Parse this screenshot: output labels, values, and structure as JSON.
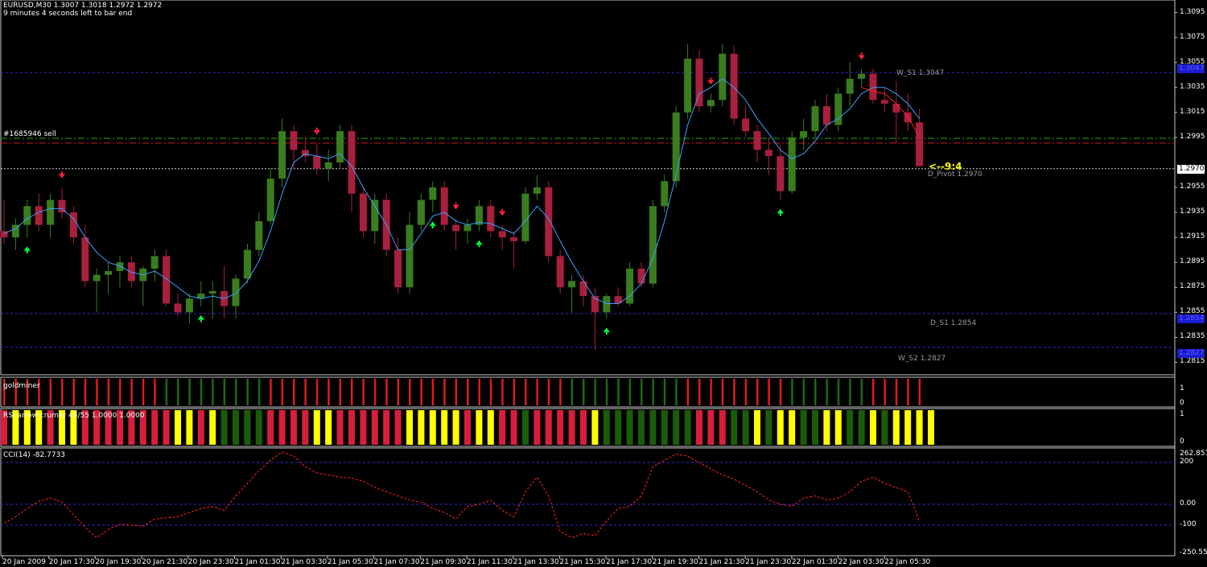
{
  "header": {
    "symbol_ohlc": "EURUSD,M30  1.3007 1.3018 1.2972 1.2972",
    "timer": "9 minutes 4 seconds left to bar end"
  },
  "order_label": "#1685946 sell",
  "countdown_label": "<--9:4",
  "price_axis": [
    "1.3095",
    "1.3075",
    "1.3055",
    "1.3035",
    "1.3015",
    "1.2995",
    "1.2955",
    "1.2935",
    "1.2915",
    "1.2895",
    "1.2875",
    "1.2855",
    "1.2835",
    "1.2815"
  ],
  "levels": {
    "ws1": {
      "text": "W_S1 1.3047",
      "box": "1.3047",
      "price": 1.3047,
      "color": "#2b2bd6"
    },
    "dpivot": {
      "text": "D_Pivot 1.2970",
      "box": "1.2970",
      "price": 1.297,
      "color": "#ffffff"
    },
    "ds1": {
      "text": "D_S1 1.2854",
      "box": "1.2854",
      "price": 1.2854,
      "color": "#2b2bd6"
    },
    "ws2": {
      "text": "W_S2 1.2827",
      "box": "1.2827",
      "price": 1.2827,
      "color": "#2b2bd6"
    }
  },
  "goldminer": {
    "title": "goldminer",
    "scale_top": "1",
    "scale_bottom": "0"
  },
  "rsi": {
    "title": "RSI arrow crumer 45/55 1.0000 1.0000",
    "scale_top": "1",
    "scale_bottom": "0"
  },
  "cci": {
    "title": "CCI(14) -82.7733",
    "scale": [
      "262.8576",
      "200",
      "0.00",
      "-100",
      "-250.557"
    ]
  },
  "time_axis": [
    "20 Jan 2009",
    "20 Jan 17:30",
    "20 Jan 19:30",
    "20 Jan 21:30",
    "20 Jan 23:30",
    "21 Jan 01:30",
    "21 Jan 03:30",
    "21 Jan 05:30",
    "21 Jan 07:30",
    "21 Jan 09:30",
    "21 Jan 11:30",
    "21 Jan 13:30",
    "21 Jan 15:30",
    "21 Jan 17:30",
    "21 Jan 19:30",
    "21 Jan 21:30",
    "21 Jan 23:30",
    "22 Jan 01:30",
    "22 Jan 03:30",
    "22 Jan 05:30"
  ],
  "colors": {
    "bull": "#3a7d1e",
    "bear": "#a8203e",
    "ma_blue": "#3aa0ff",
    "ma_red": "#ff2020",
    "level_blue": "#2b2bd6",
    "order": "#22aa22",
    "gold_green": "#1f6a12",
    "gold_red": "#e01c1c",
    "rsi_yellow": "#ffff00",
    "rsi_red": "#d81e3c",
    "rsi_green": "#1a5c0a",
    "cci_line": "#ff2020",
    "countdown": "#ffff00"
  },
  "chart_data": {
    "type": "candlestick",
    "symbol": "EURUSD",
    "timeframe": "M30",
    "ylim": [
      1.2805,
      1.3105
    ],
    "candles": [
      [
        1.292,
        1.2945,
        1.291,
        1.2915
      ],
      [
        1.2915,
        1.293,
        1.2905,
        1.2925
      ],
      [
        1.2925,
        1.2945,
        1.2915,
        1.294
      ],
      [
        1.294,
        1.295,
        1.292,
        1.2925
      ],
      [
        1.2925,
        1.295,
        1.2915,
        1.2945
      ],
      [
        1.2945,
        1.2955,
        1.293,
        1.2935
      ],
      [
        1.2935,
        1.294,
        1.291,
        1.2915
      ],
      [
        1.2915,
        1.2925,
        1.2875,
        1.288
      ],
      [
        1.288,
        1.289,
        1.2855,
        1.2885
      ],
      [
        1.2885,
        1.2895,
        1.287,
        1.2888
      ],
      [
        1.2888,
        1.29,
        1.2875,
        1.2895
      ],
      [
        1.2895,
        1.29,
        1.2875,
        1.288
      ],
      [
        1.288,
        1.2892,
        1.286,
        1.289
      ],
      [
        1.289,
        1.2905,
        1.288,
        1.29
      ],
      [
        1.29,
        1.2905,
        1.286,
        1.2862
      ],
      [
        1.2862,
        1.287,
        1.2852,
        1.2855
      ],
      [
        1.2855,
        1.287,
        1.2846,
        1.2866
      ],
      [
        1.2866,
        1.288,
        1.286,
        1.287
      ],
      [
        1.287,
        1.288,
        1.285,
        1.2872
      ],
      [
        1.2872,
        1.2892,
        1.285,
        1.286
      ],
      [
        1.286,
        1.2885,
        1.285,
        1.2882
      ],
      [
        1.2882,
        1.291,
        1.2878,
        1.2905
      ],
      [
        1.2905,
        1.2935,
        1.29,
        1.2928
      ],
      [
        1.2928,
        1.297,
        1.2925,
        1.2962
      ],
      [
        1.2962,
        1.301,
        1.2955,
        1.3
      ],
      [
        1.3,
        1.3005,
        1.297,
        1.2985
      ],
      [
        1.2985,
        1.2995,
        1.2975,
        1.298
      ],
      [
        1.298,
        1.299,
        1.2965,
        1.297
      ],
      [
        1.297,
        1.2985,
        1.296,
        1.2975
      ],
      [
        1.2975,
        1.3005,
        1.297,
        1.3
      ],
      [
        1.3,
        1.3005,
        1.2935,
        1.295
      ],
      [
        1.295,
        1.2955,
        1.2915,
        1.292
      ],
      [
        1.292,
        1.295,
        1.291,
        1.2945
      ],
      [
        1.2945,
        1.295,
        1.29,
        1.2905
      ],
      [
        1.2905,
        1.2915,
        1.287,
        1.2875
      ],
      [
        1.2875,
        1.2935,
        1.287,
        1.2925
      ],
      [
        1.2925,
        1.295,
        1.292,
        1.2945
      ],
      [
        1.2945,
        1.296,
        1.2935,
        1.2955
      ],
      [
        1.2955,
        1.296,
        1.292,
        1.2925
      ],
      [
        1.2925,
        1.293,
        1.2905,
        1.292
      ],
      [
        1.292,
        1.293,
        1.291,
        1.2925
      ],
      [
        1.2925,
        1.2945,
        1.292,
        1.294
      ],
      [
        1.294,
        1.2945,
        1.2915,
        1.292
      ],
      [
        1.292,
        1.2925,
        1.2905,
        1.2915
      ],
      [
        1.2915,
        1.292,
        1.289,
        1.2912
      ],
      [
        1.2912,
        1.2955,
        1.291,
        1.295
      ],
      [
        1.295,
        1.2965,
        1.2945,
        1.2955
      ],
      [
        1.2955,
        1.296,
        1.2895,
        1.29
      ],
      [
        1.29,
        1.2905,
        1.287,
        1.2875
      ],
      [
        1.2875,
        1.2885,
        1.2855,
        1.288
      ],
      [
        1.288,
        1.2885,
        1.286,
        1.2868
      ],
      [
        1.2868,
        1.2875,
        1.2825,
        1.2855
      ],
      [
        1.2855,
        1.287,
        1.285,
        1.2868
      ],
      [
        1.2868,
        1.2875,
        1.286,
        1.2862
      ],
      [
        1.2862,
        1.2895,
        1.286,
        1.289
      ],
      [
        1.289,
        1.2895,
        1.2875,
        1.2878
      ],
      [
        1.2878,
        1.2945,
        1.2875,
        1.294
      ],
      [
        1.294,
        1.2965,
        1.2935,
        1.296
      ],
      [
        1.296,
        1.302,
        1.2955,
        1.3015
      ],
      [
        1.3015,
        1.307,
        1.301,
        1.3058
      ],
      [
        1.3058,
        1.3065,
        1.3015,
        1.302
      ],
      [
        1.302,
        1.303,
        1.3015,
        1.3025
      ],
      [
        1.3025,
        1.307,
        1.302,
        1.3062
      ],
      [
        1.3062,
        1.3068,
        1.3005,
        1.301
      ],
      [
        1.301,
        1.302,
        1.2995,
        1.3
      ],
      [
        1.3,
        1.3005,
        1.2975,
        1.2985
      ],
      [
        1.2985,
        1.2995,
        1.2965,
        1.298
      ],
      [
        1.298,
        1.299,
        1.2945,
        1.2952
      ],
      [
        1.2952,
        1.3,
        1.295,
        1.2995
      ],
      [
        1.2995,
        1.301,
        1.2985,
        1.3
      ],
      [
        1.3,
        1.3025,
        1.2995,
        1.302
      ],
      [
        1.302,
        1.303,
        1.3,
        1.3005
      ],
      [
        1.3005,
        1.3035,
        1.3,
        1.303
      ],
      [
        1.303,
        1.3055,
        1.302,
        1.3042
      ],
      [
        1.3042,
        1.305,
        1.3035,
        1.3046
      ],
      [
        1.3046,
        1.305,
        1.3022,
        1.3025
      ],
      [
        1.3025,
        1.3035,
        1.3015,
        1.3022
      ],
      [
        1.3022,
        1.304,
        1.299,
        1.3015
      ],
      [
        1.3015,
        1.303,
        1.3,
        1.3007
      ],
      [
        1.3007,
        1.3018,
        1.2972,
        1.2972
      ]
    ],
    "arrows": [
      {
        "i": 2,
        "dir": "up"
      },
      {
        "i": 5,
        "dir": "down"
      },
      {
        "i": 17,
        "dir": "up"
      },
      {
        "i": 27,
        "dir": "down"
      },
      {
        "i": 37,
        "dir": "up"
      },
      {
        "i": 39,
        "dir": "down"
      },
      {
        "i": 41,
        "dir": "up"
      },
      {
        "i": 43,
        "dir": "down"
      },
      {
        "i": 52,
        "dir": "up"
      },
      {
        "i": 61,
        "dir": "down"
      },
      {
        "i": 67,
        "dir": "up"
      },
      {
        "i": 74,
        "dir": "down"
      }
    ],
    "goldminer_bars": [
      "r",
      "r",
      "r",
      "r",
      "r",
      "r",
      "r",
      "r",
      "r",
      "r",
      "r",
      "r",
      "r",
      "r",
      "g",
      "g",
      "g",
      "g",
      "g",
      "g",
      "g",
      "g",
      "g",
      "r",
      "r",
      "r",
      "r",
      "r",
      "r",
      "r",
      "r",
      "r",
      "r",
      "r",
      "r",
      "r",
      "r",
      "r",
      "r",
      "r",
      "r",
      "r",
      "r",
      "r",
      "r",
      "r",
      "r",
      "r",
      "r",
      "g",
      "g",
      "g",
      "g",
      "g",
      "g",
      "g",
      "g",
      "g",
      "g",
      "r",
      "r",
      "r",
      "r",
      "r",
      "r",
      "r",
      "r",
      "r",
      "g",
      "g",
      "g",
      "g",
      "g",
      "g",
      "g",
      "r",
      "r",
      "r",
      "r",
      "r"
    ],
    "rsi_bars": [
      "r",
      "y",
      "y",
      "y",
      "r",
      "y",
      "y",
      "r",
      "r",
      "r",
      "r",
      "r",
      "r",
      "r",
      "r",
      "y",
      "y",
      "r",
      "y",
      "g",
      "g",
      "g",
      "g",
      "r",
      "r",
      "r",
      "r",
      "y",
      "y",
      "r",
      "r",
      "r",
      "r",
      "r",
      "r",
      "y",
      "y",
      "y",
      "y",
      "y",
      "r",
      "y",
      "y",
      "r",
      "r",
      "g",
      "r",
      "r",
      "r",
      "r",
      "r",
      "y",
      "g",
      "g",
      "g",
      "g",
      "g",
      "g",
      "g",
      "g",
      "r",
      "r",
      "r",
      "g",
      "g",
      "y",
      "g",
      "y",
      "y",
      "g",
      "g",
      "y",
      "y",
      "g",
      "g",
      "y",
      "g",
      "y",
      "y",
      "y",
      "y"
    ],
    "cci": [
      -90,
      -60,
      -20,
      15,
      30,
      10,
      -50,
      -110,
      -160,
      -120,
      -95,
      -100,
      -105,
      -70,
      -65,
      -60,
      -40,
      -20,
      -10,
      -30,
      40,
      100,
      160,
      210,
      250,
      230,
      180,
      150,
      140,
      130,
      125,
      110,
      80,
      60,
      40,
      20,
      10,
      -20,
      -40,
      -70,
      -10,
      0,
      20,
      -30,
      -60,
      60,
      130,
      40,
      -130,
      -160,
      -140,
      -150,
      -80,
      -20,
      -10,
      40,
      180,
      210,
      240,
      230,
      200,
      170,
      140,
      120,
      90,
      60,
      20,
      0,
      -10,
      30,
      40,
      20,
      30,
      60,
      110,
      130,
      100,
      80,
      60,
      -82
    ],
    "ma_blue": [
      1.2918,
      1.2922,
      1.293,
      1.2935,
      1.2938,
      1.2938,
      1.293,
      1.2915,
      1.2903,
      1.2895,
      1.2892,
      1.2887,
      1.2885,
      1.2888,
      1.2882,
      1.2875,
      1.2868,
      1.2866,
      1.2868,
      1.2866,
      1.287,
      1.288,
      1.2896,
      1.292,
      1.295,
      1.2975,
      1.2982,
      1.298,
      1.2978,
      1.2982,
      1.2972,
      1.2955,
      1.294,
      1.2925,
      1.2905,
      1.2905,
      1.2918,
      1.2932,
      1.2935,
      1.2928,
      1.2925,
      1.2927,
      1.2926,
      1.2922,
      1.2918,
      1.2928,
      1.294,
      1.293,
      1.2912,
      1.2895,
      1.288,
      1.2866,
      1.2862,
      1.2862,
      1.2868,
      1.2878,
      1.2898,
      1.2928,
      1.2965,
      1.3005,
      1.303,
      1.3035,
      1.3042,
      1.3035,
      1.3025,
      1.301,
      1.2998,
      1.2985,
      1.2978,
      1.2982,
      1.2992,
      1.3005,
      1.301,
      1.3018,
      1.303,
      1.3035,
      1.3035,
      1.303,
      1.3022,
      1.301
    ],
    "ma_red_start": 74,
    "ma_red_tail": [
      1.3035,
      1.3032,
      1.303,
      1.3022,
      1.3012,
      1.2995
    ]
  }
}
